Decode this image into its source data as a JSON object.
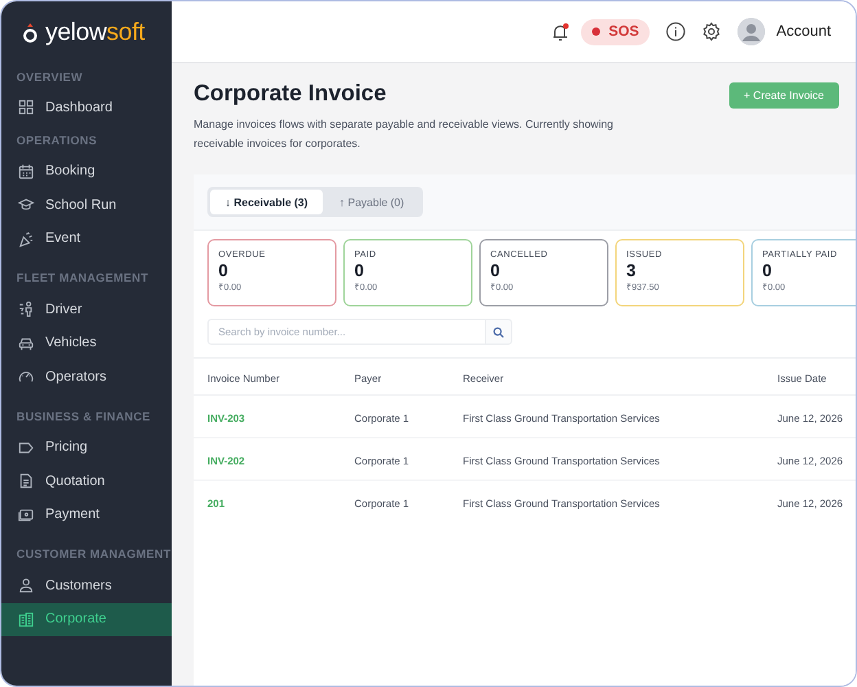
{
  "logo": {
    "first": "yelow",
    "second": "soft"
  },
  "sidebar": {
    "sections": [
      {
        "title": "OVERVIEW",
        "items": [
          {
            "label": "Dashboard",
            "selected": false
          }
        ]
      },
      {
        "title": "OPERATIONS",
        "items": [
          {
            "label": "Booking",
            "selected": false
          },
          {
            "label": "School Run",
            "selected": false
          },
          {
            "label": "Event",
            "selected": false
          }
        ]
      },
      {
        "title": "FLEET MANAGEMENT",
        "items": [
          {
            "label": "Driver",
            "selected": false
          },
          {
            "label": "Vehicles",
            "selected": false
          },
          {
            "label": "Operators",
            "selected": false
          }
        ]
      },
      {
        "title": "BUSINESS & FINANCE",
        "items": [
          {
            "label": "Pricing",
            "selected": false
          },
          {
            "label": "Quotation",
            "selected": false
          },
          {
            "label": "Payment",
            "selected": false
          }
        ]
      },
      {
        "title": "CUSTOMER MANAGMENT",
        "items": [
          {
            "label": "Customers",
            "selected": false
          },
          {
            "label": "Corporate",
            "selected": true
          }
        ]
      }
    ]
  },
  "topbar": {
    "sos": "SOS",
    "account": "Account"
  },
  "page": {
    "title": "Corporate Invoice",
    "description": "Manage invoices flows with separate payable and receivable views. Currently showing receivable invoices for corporates.",
    "create_button": "+ Create Invoice"
  },
  "tabs": [
    {
      "label": "↓ Receivable (3)",
      "selected": true
    },
    {
      "label": "↑ Payable (0)",
      "selected": false
    }
  ],
  "cards": [
    {
      "label": "OVERDUE",
      "count": "0",
      "amount": "₹0.00",
      "color": "#e49aa2"
    },
    {
      "label": "PAID",
      "count": "0",
      "amount": "₹0.00",
      "color": "#9fd49a"
    },
    {
      "label": "CANCELLED",
      "count": "0",
      "amount": "₹0.00",
      "color": "#9c9ea6"
    },
    {
      "label": "ISSUED",
      "count": "3",
      "amount": "₹937.50",
      "color": "#f3d57c"
    },
    {
      "label": "PARTIALLY PAID",
      "count": "0",
      "amount": "₹0.00",
      "color": "#a8cfe0"
    }
  ],
  "search": {
    "placeholder": "Search by invoice number..."
  },
  "table": {
    "columns": [
      "Invoice Number",
      "Payer",
      "Receiver",
      "Issue Date"
    ],
    "rows": [
      [
        "INV-203",
        "Corporate 1",
        "First Class Ground Transportation Services",
        "June 12, 2026"
      ],
      [
        "INV-202",
        "Corporate 1",
        "First Class Ground Transportation Services",
        "June 12, 2026"
      ],
      [
        "201",
        "Corporate 1",
        "First Class Ground Transportation Services",
        "June 12, 2026"
      ]
    ]
  }
}
